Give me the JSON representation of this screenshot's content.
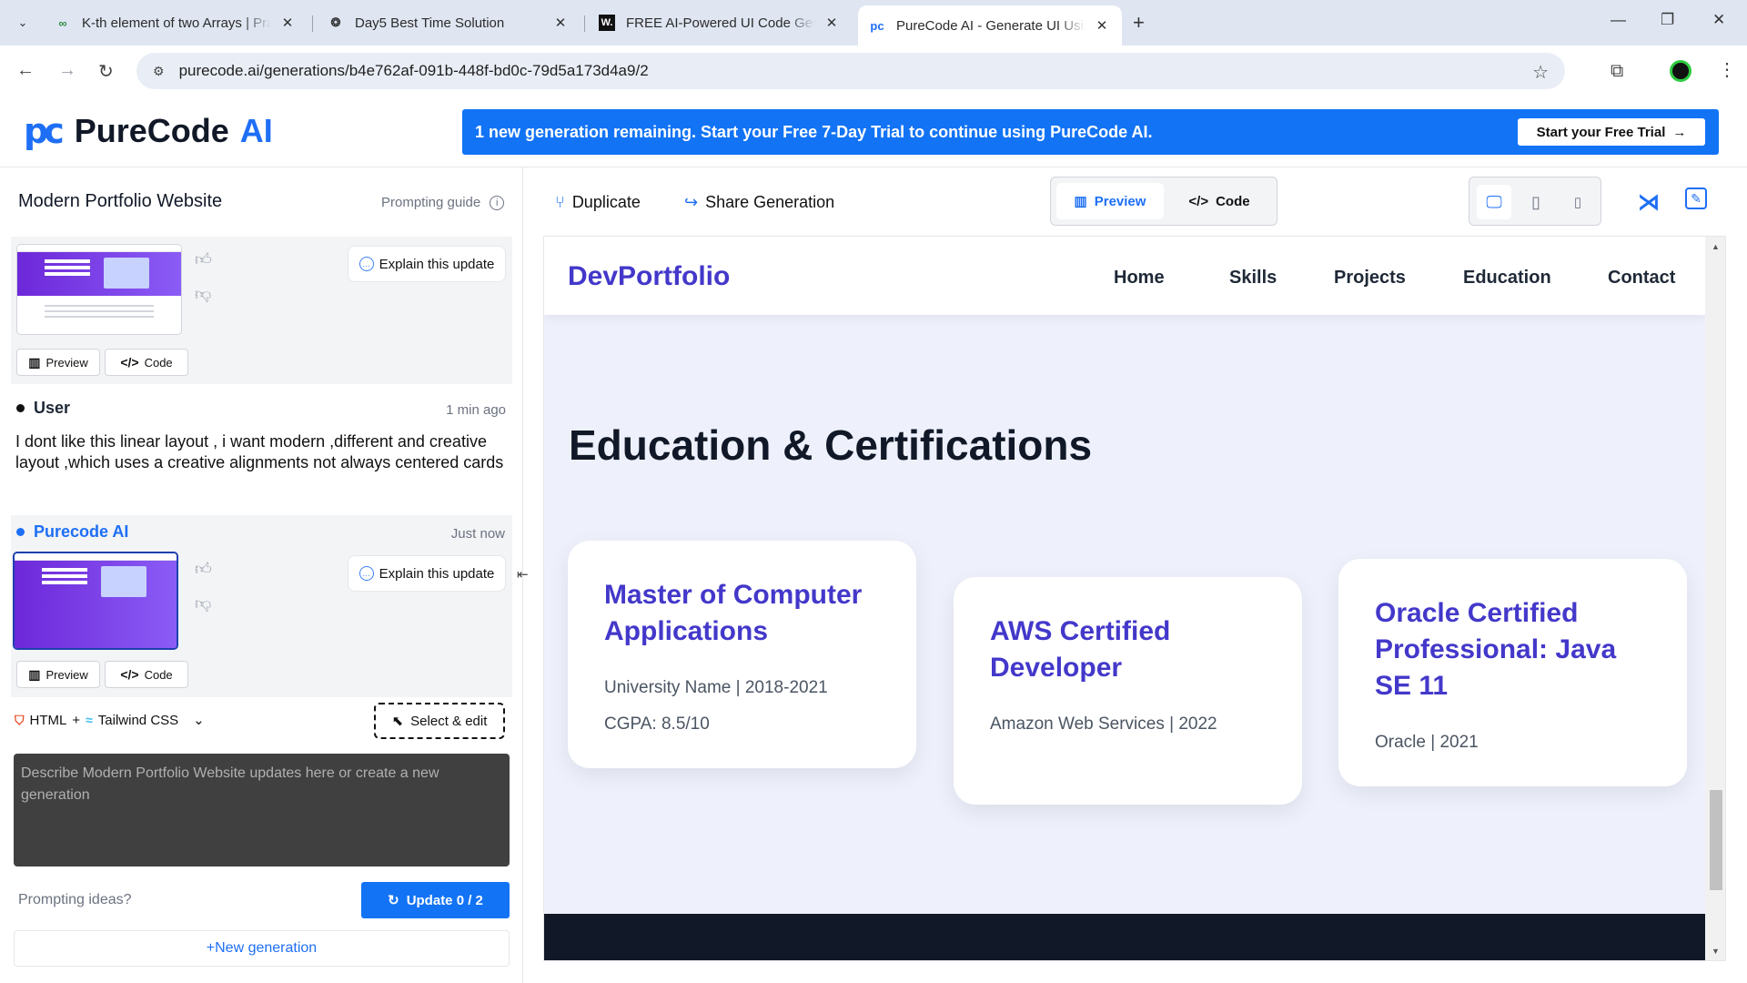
{
  "browser": {
    "tabs": [
      {
        "label": "K-th element of two Arrays | Pra",
        "icon": "gfg-icon"
      },
      {
        "label": "Day5 Best Time Solution",
        "icon": "openai-icon"
      },
      {
        "label": "FREE AI-Powered UI Code Gene",
        "icon": "w-icon"
      },
      {
        "label": "PureCode AI - Generate UI Usin",
        "icon": "purecode-icon"
      }
    ],
    "url": "purecode.ai/generations/b4e762af-091b-448f-bd0c-79d5a173d4a9/2"
  },
  "header": {
    "logo_mark": "pc",
    "logo_text": "PureCode",
    "logo_ai": "AI",
    "banner_text": "1 new generation remaining. Start your Free 7-Day Trial to continue using PureCode AI.",
    "trial_button": "Start your Free Trial",
    "accent_color": "#1273f5"
  },
  "left": {
    "project_title": "Modern Portfolio Website",
    "prompting_guide": "Prompting guide",
    "explain_label": "Explain this update",
    "preview_label": "Preview",
    "code_label": "Code",
    "user": {
      "role": "User",
      "time": "1 min ago",
      "message": "I dont like this linear layout , i want modern ,different and creative layout ,which uses a creative alignments not always centered cards"
    },
    "ai": {
      "role": "Purecode AI",
      "time": "Just now"
    },
    "stack_html": "HTML",
    "stack_plus": "+",
    "stack_css": "Tailwind CSS",
    "select_edit": "Select & edit",
    "prompt_placeholder": "Describe Modern Portfolio Website updates here or create a new generation",
    "prompting_ideas": "Prompting ideas?",
    "update_button": "Update 0 / 2",
    "new_generation": "+New generation"
  },
  "toolbar": {
    "duplicate": "Duplicate",
    "share": "Share Generation",
    "preview_tab": "Preview",
    "code_tab": "Code",
    "active_tab": "Preview",
    "active_device": "desktop"
  },
  "preview": {
    "brand": "DevPortfolio",
    "nav": [
      "Home",
      "Skills",
      "Projects",
      "Education",
      "Contact"
    ],
    "heading": "Education & Certifications",
    "cards": [
      {
        "title": "Master of Computer Applications",
        "lines": [
          "University Name | 2018-2021",
          "CGPA: 8.5/10"
        ]
      },
      {
        "title": "AWS Certified Developer",
        "lines": [
          "Amazon Web Services | 2022"
        ]
      },
      {
        "title": "Oracle Certified Professional: Java SE 11",
        "lines": [
          "Oracle | 2021"
        ]
      }
    ],
    "brand_color": "#4338ca",
    "footer_color": "#111827"
  }
}
